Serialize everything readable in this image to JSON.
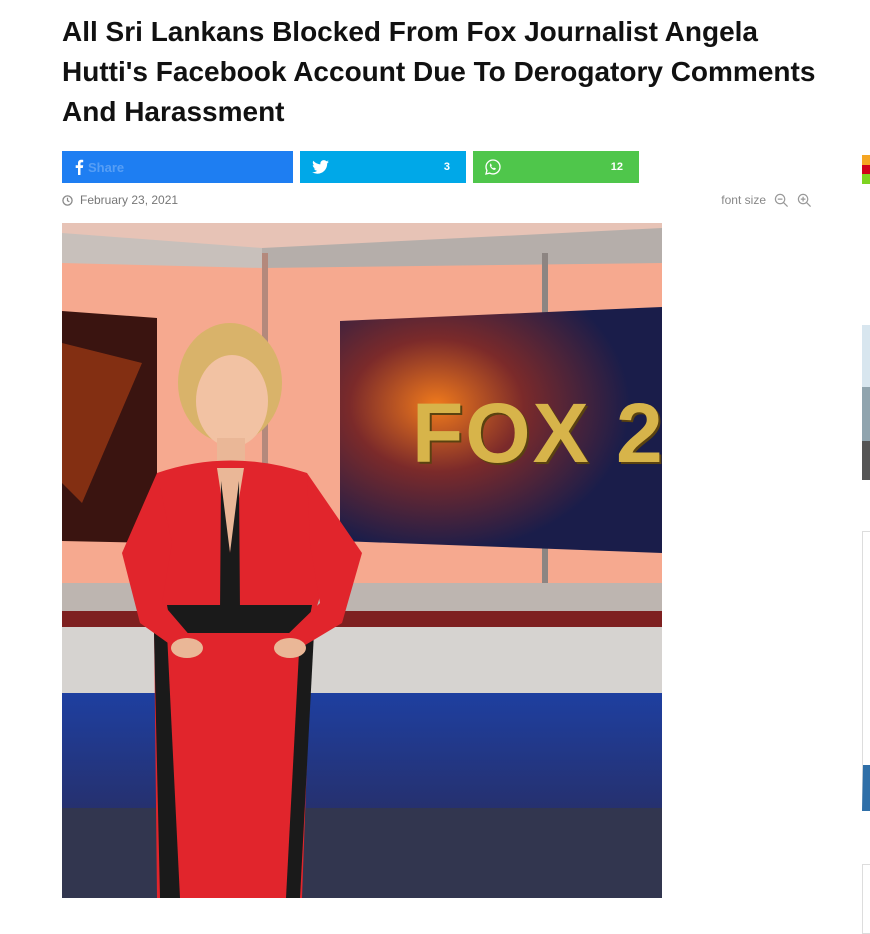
{
  "article": {
    "title": "All Sri Lankans Blocked From Fox Journalist Angela Hutti's Facebook Account Due To Derogatory Comments And Harassment",
    "date": "February 23, 2021"
  },
  "share": {
    "facebook": {
      "icon": "facebook-icon",
      "label": "Share",
      "color": "#1e7ef2"
    },
    "twitter": {
      "icon": "twitter-icon",
      "count": "3",
      "color": "#00a8e8"
    },
    "whatsapp": {
      "icon": "whatsapp-icon",
      "count": "12",
      "color": "#4fc64b"
    }
  },
  "tools": {
    "font_size_label": "font size",
    "decrease_icon": "zoom-out-icon",
    "increase_icon": "zoom-in-icon"
  },
  "image": {
    "studio_sign": "FOX 2"
  }
}
